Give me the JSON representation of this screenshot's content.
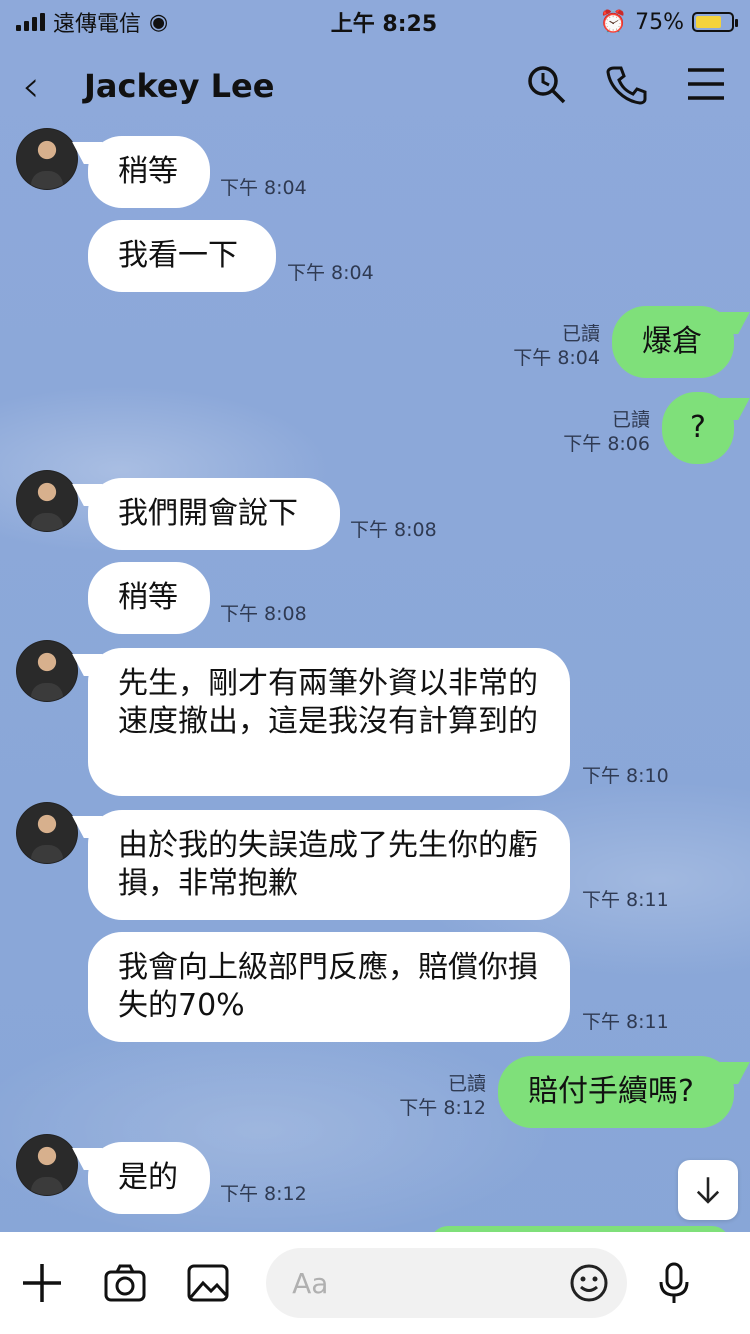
{
  "status_bar": {
    "carrier": "遠傳電信",
    "time": "上午 8:25",
    "battery": "75%",
    "battery_level": 0.75
  },
  "header": {
    "back_glyph": "‹",
    "title": "Jackey Lee"
  },
  "messages": [
    {
      "side": "left",
      "text": "稍等",
      "time": "下午 8:04"
    },
    {
      "side": "left",
      "text": "我看一下",
      "time": "下午 8:04"
    },
    {
      "side": "right",
      "text": "爆倉",
      "read": "已讀",
      "time": "下午 8:04"
    },
    {
      "side": "right",
      "text": "?",
      "read": "已讀",
      "time": "下午 8:06"
    },
    {
      "side": "left",
      "text": "我們開會說下",
      "time": "下午 8:08"
    },
    {
      "side": "left",
      "text": "稍等",
      "time": "下午 8:08"
    },
    {
      "side": "left",
      "text": "先生，剛才有兩筆外資以非常的速度撤出，這是我沒有計算到的",
      "time": "下午 8:10"
    },
    {
      "side": "left",
      "text": "由於我的失誤造成了先生你的虧損，非常抱歉",
      "time": "下午 8:11"
    },
    {
      "side": "left",
      "text": "我會向上級部門反應，賠償你損失的70%",
      "time": "下午 8:11"
    },
    {
      "side": "right",
      "text": "賠付手續嗎?",
      "read": "已讀",
      "time": "下午 8:12"
    },
    {
      "side": "left",
      "text": "是的",
      "time": "下午 8:12"
    }
  ],
  "input": {
    "placeholder": "Aa"
  },
  "colors": {
    "background": "#8aa8d8",
    "outgoing_bubble": "#7fe07a",
    "incoming_bubble": "#ffffff"
  },
  "icons": [
    "back-icon",
    "search-icon",
    "phone-icon",
    "menu-icon",
    "plus-icon",
    "camera-icon",
    "image-icon",
    "emoji-icon",
    "mic-icon",
    "arrow-down-icon"
  ]
}
